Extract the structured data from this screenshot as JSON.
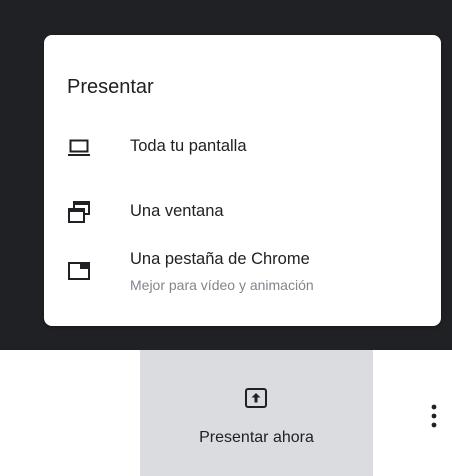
{
  "menu": {
    "title": "Presentar",
    "items": [
      {
        "label": "Toda tu pantalla",
        "icon": "laptop-icon"
      },
      {
        "label": "Una ventana",
        "icon": "window-icon"
      },
      {
        "label": "Una pestaña de Chrome",
        "sublabel": "Mejor para vídeo y animación",
        "icon": "tab-icon"
      }
    ]
  },
  "toolbar": {
    "present_label": "Presentar ahora",
    "present_icon": "present-to-all-icon",
    "more_icon": "more-vert-icon"
  },
  "colors": {
    "backdrop": "#202124",
    "panel": "#ffffff",
    "button_bg": "#dadce0",
    "text_primary": "#202124",
    "text_secondary": "#80868b"
  }
}
